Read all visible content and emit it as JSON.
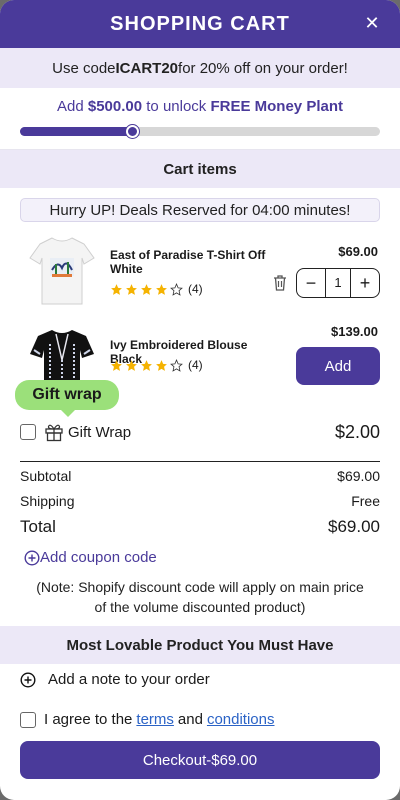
{
  "header": {
    "title": "SHOPPING CART",
    "close_glyph": "✕"
  },
  "promo": {
    "prefix": "Use code ",
    "code": "ICART20",
    "suffix": " for 20% off on your order!"
  },
  "unlock": {
    "prefix": "Add ",
    "amount": "$500.00",
    "middle": " to unlock ",
    "reward": "FREE Money Plant",
    "progress_fraction": 0.31
  },
  "cart_section": {
    "title": "Cart items",
    "deal": "Hurry UP! Deals Reserved for 04:00 minutes!"
  },
  "items": [
    {
      "name": "East of Paradise T-Shirt Off White",
      "rating_filled": 4,
      "rating_count": "(4)",
      "price": "$69.00",
      "quantity": "1"
    },
    {
      "name": "Ivy Embroidered Blouse Black",
      "rating_filled": 4,
      "rating_count": "(4)",
      "price": "$139.00",
      "add_label": "Add"
    }
  ],
  "gift": {
    "tooltip": "Gift wrap",
    "label": "Gift Wrap",
    "price": "$2.00"
  },
  "summary": {
    "subtotal_label": "Subtotal",
    "subtotal": "$69.00",
    "shipping_label": "Shipping",
    "shipping": "Free",
    "total_label": "Total",
    "total": "$69.00"
  },
  "coupon": {
    "label": "Add coupon code"
  },
  "note": "(Note: Shopify discount code will apply on main price of the volume discounted product)",
  "lovable": {
    "title": "Most Lovable Product You Must Have"
  },
  "order_note": {
    "label": "Add a note to your order"
  },
  "agree": {
    "prefix": "I agree to the",
    "terms": "terms",
    "and": "and",
    "conditions": "conditions"
  },
  "checkout": {
    "label": "Checkout-$69.00"
  },
  "colors": {
    "brand": "#4a3a9a",
    "tooltip": "#9be07a",
    "link": "#2b63c6",
    "star": "#f5b301"
  }
}
